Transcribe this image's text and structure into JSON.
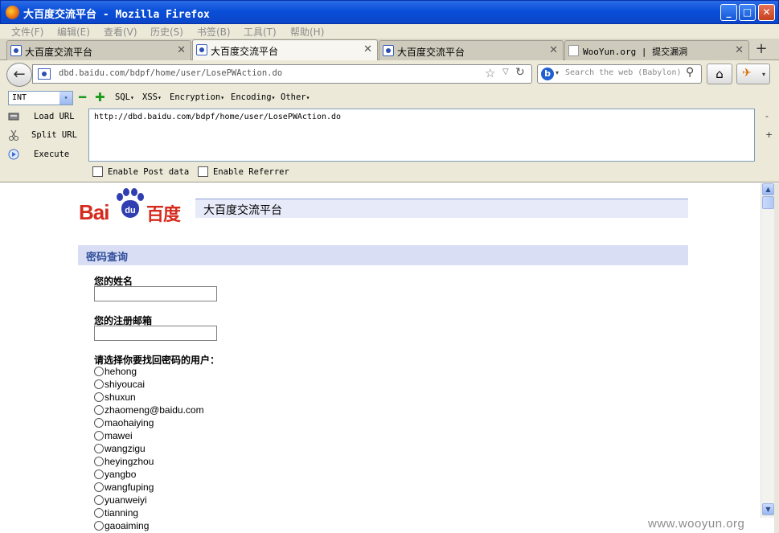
{
  "window": {
    "title": "大百度交流平台 - Mozilla Firefox",
    "minimize": "_",
    "maximize": "□",
    "close": "✕"
  },
  "menu": [
    "文件(F)",
    "编辑(E)",
    "查看(V)",
    "历史(S)",
    "书签(B)",
    "工具(T)",
    "帮助(H)"
  ],
  "tabs": [
    {
      "label": "大百度交流平台",
      "icon": "baidu-paw-icon",
      "close": "✕"
    },
    {
      "label": "大百度交流平台",
      "icon": "baidu-paw-icon",
      "close": "✕"
    },
    {
      "label": "大百度交流平台",
      "icon": "baidu-paw-icon",
      "close": "✕"
    },
    {
      "label": "WooYun.org | 提交漏洞",
      "icon": "page-icon",
      "close": "✕"
    }
  ],
  "new_tab": "+",
  "nav": {
    "back": "←",
    "url": "dbd.baidu.com/bdpf/home/user/LosePWAction.do",
    "star": "☆",
    "dropdown": "▽",
    "reload": "↻",
    "search_engine": "b",
    "search_caret": "▾",
    "search_placeholder": "Search the web (Babylon)",
    "search_button": "⚲",
    "home": "⌂",
    "ext_icon": "✈",
    "ext_caret": "▾"
  },
  "hackbar": {
    "type_select": "INT",
    "select_arrow": "▾",
    "minus": "━",
    "plus": "✚",
    "menus": [
      "SQL",
      "XSS",
      "Encryption",
      "Encoding",
      "Other"
    ],
    "load_url": "Load URL",
    "split_url": "Split URL",
    "execute": "Execute",
    "url_value": "http://dbd.baidu.com/bdpf/home/user/LosePWAction.do",
    "side_minus": "-",
    "side_plus": "+",
    "enable_post": "Enable Post data",
    "enable_referrer": "Enable Referrer"
  },
  "page": {
    "logo_bai": "Bai",
    "logo_du": "du",
    "logo_cn": "百度",
    "site_title": "大百度交流平台",
    "section_title": "密码查询",
    "name_label": "您的姓名",
    "email_label": "您的注册邮箱",
    "choose_label": "请选择你要找回密码的用户：",
    "users": [
      "hehong",
      "shiyoucai",
      "shuxun",
      "zhaomeng@baidu.com",
      "maohaiying",
      "mawei",
      "wangzigu",
      "heyingzhou",
      "yangbo",
      "wangfuping",
      "yuanweiyi",
      "tianning",
      "gaoaiming"
    ]
  },
  "scroll": {
    "up": "▲",
    "down": "▼"
  },
  "watermark": "www.wooyun.org"
}
